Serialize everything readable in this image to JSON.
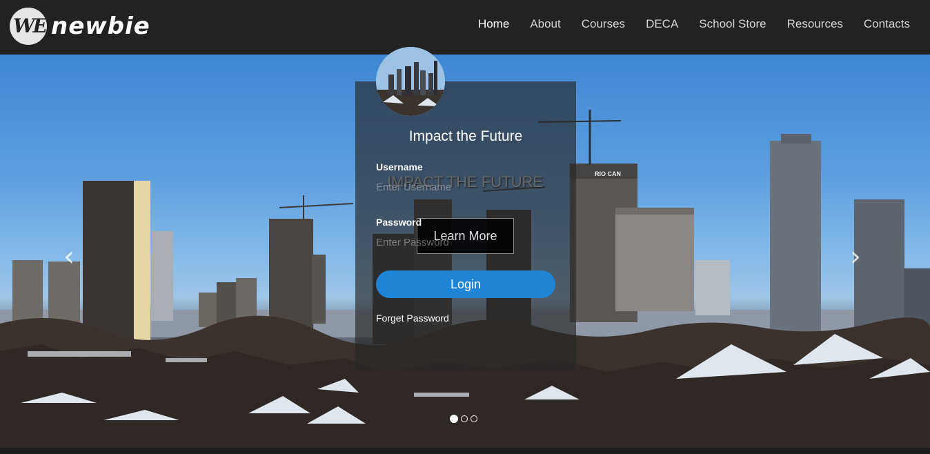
{
  "brand": {
    "logo_mark": "WE",
    "name": "newbie"
  },
  "nav": {
    "items": [
      {
        "label": "Home",
        "active": true
      },
      {
        "label": "About"
      },
      {
        "label": "Courses"
      },
      {
        "label": "DECA"
      },
      {
        "label": "School Store"
      },
      {
        "label": "Resources"
      },
      {
        "label": "Contacts"
      }
    ]
  },
  "carousel": {
    "caption_title": "IMPACT THE FUTURE",
    "caption_button": "Learn More",
    "prev_icon": "chevron-left-icon",
    "next_icon": "chevron-right-icon",
    "slide_count": 3,
    "active_slide": 1,
    "building_sign": "RIO CAN"
  },
  "login": {
    "title": "Impact the Future",
    "username_label": "Username",
    "username_placeholder": "Enter Username",
    "password_label": "Password",
    "password_placeholder": "Enter Password",
    "submit_label": "Login",
    "forget_label": "Forget Password",
    "accent_color": "#1e84d6"
  }
}
